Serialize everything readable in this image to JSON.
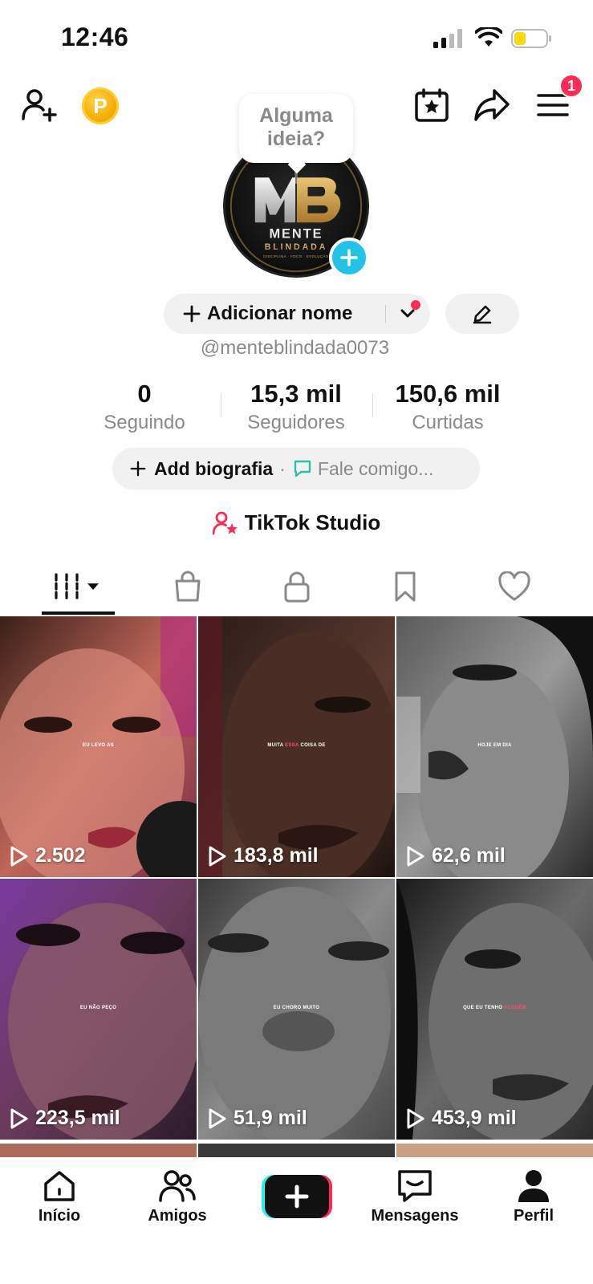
{
  "status_bar": {
    "time": "12:46"
  },
  "top_bar": {
    "coin_letter": "P",
    "notification_count": "1"
  },
  "avatar": {
    "brand_line1": "MENTE",
    "brand_line2": "BLINDADA",
    "brand_tagline": "DISCIPLINA · FOCO · EVOLUÇÃO"
  },
  "idea_bubble": {
    "line1": "Alguma",
    "line2": "ideia?"
  },
  "profile": {
    "add_name_label": "Adicionar nome",
    "username": "@menteblindada0073"
  },
  "stats": [
    {
      "value": "0",
      "label": "Seguindo"
    },
    {
      "value": "15,3 mil",
      "label": "Seguidores"
    },
    {
      "value": "150,6 mil",
      "label": "Curtidas"
    }
  ],
  "bio": {
    "add_bio_label": "Add biografia",
    "separator": "·",
    "contact_label": "Fale comigo..."
  },
  "studio": {
    "label": "TikTok Studio"
  },
  "tabs": [
    {
      "icon": "grid-icon"
    },
    {
      "icon": "shopping-bag-icon"
    },
    {
      "icon": "lock-icon"
    },
    {
      "icon": "bookmark-icon"
    },
    {
      "icon": "heart-icon"
    }
  ],
  "videos": [
    {
      "views": "2.502",
      "caption": "EU LEVO AS",
      "highlight": ""
    },
    {
      "views": "183,8 mil",
      "caption": "MUITA ",
      "highlight": "ESSA",
      "caption_after": " COISA DE"
    },
    {
      "views": "62,6 mil",
      "caption": "HOJE EM DIA",
      "highlight": ""
    },
    {
      "views": "223,5 mil",
      "caption": "EU NÃO PEÇO",
      "highlight": ""
    },
    {
      "views": "51,9 mil",
      "caption": "EU CHORO MUITO",
      "highlight": ""
    },
    {
      "views": "453,9 mil",
      "caption": "QUE EU TENHO ",
      "highlight": "ALGUÉM"
    }
  ],
  "bottom_nav": [
    {
      "label": "Início",
      "icon": "home-icon"
    },
    {
      "label": "Amigos",
      "icon": "friends-icon"
    },
    {
      "label": "",
      "icon": "create-plus-icon"
    },
    {
      "label": "Mensagens",
      "icon": "messages-icon"
    },
    {
      "label": "Perfil",
      "icon": "profile-icon"
    }
  ],
  "colors": {
    "accent": "#fe2c55",
    "cyan": "#22c3e6",
    "muted": "#8a8a8a",
    "pill_bg": "#f1f1f2"
  }
}
